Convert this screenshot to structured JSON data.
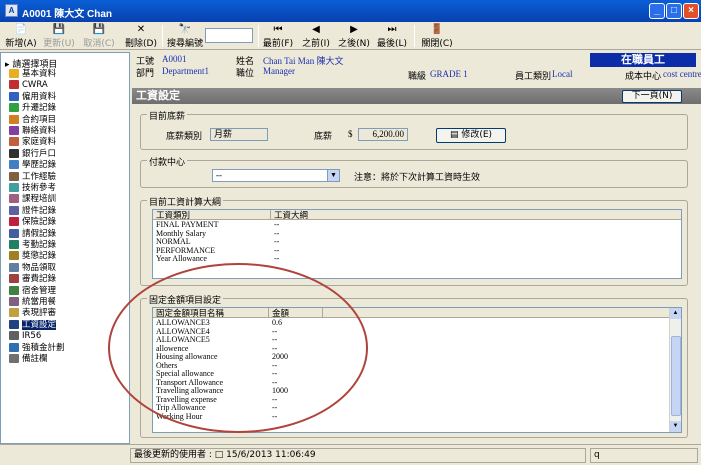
{
  "window": {
    "title": "A0001 陳大文 Chan",
    "min": "_",
    "max": "□",
    "close": "×"
  },
  "toolbar": {
    "new": "新增(A)",
    "update": "更新(U)",
    "cancel": "取消(C)",
    "delete": "刪除(D)",
    "search": "搜尋編號",
    "first": "最前(F)",
    "prev": "之前(I)",
    "next": "之後(N)",
    "last": "最後(L)",
    "close": "關閉(C)"
  },
  "tree": {
    "root": "請選擇項目",
    "items": [
      "基本資料",
      "CWRA",
      "僱用資料",
      "升遷記錄",
      "合約項目",
      "聯絡資料",
      "家庭資料",
      "銀行戶口",
      "學歷記錄",
      "工作經驗",
      "技術參考",
      "課程培訓",
      "證件記錄",
      "保險記錄",
      "請假記錄",
      "考勤記錄",
      "獎懲記錄",
      "物品領取",
      "審費記錄",
      "宿舍管理",
      "統當用餐",
      "表現評審",
      "工資設定",
      "IR56",
      "強積金計劃",
      "備註欄"
    ],
    "selected_index": 22
  },
  "header": {
    "emp_no_label": "工號",
    "emp_no": "A0001",
    "dept_label": "部門",
    "dept": "Department1",
    "name_label": "姓名",
    "name": "Chan Tai Man 陳大文",
    "position_label": "職位",
    "position": "Manager",
    "grade_label": "職級",
    "grade": "GRADE 1",
    "emp_type_label": "員工類別",
    "emp_type": "Local",
    "cost_center_label": "成本中心",
    "cost_center": "cost centre",
    "status": "在職員工"
  },
  "section": {
    "title": "工資設定",
    "next_btn": "下一頁(N)"
  },
  "base_salary": {
    "group": "目前底薪",
    "type_label": "底薪類別",
    "type_value": "月薪",
    "amount_label": "底薪",
    "currency": "$",
    "amount": "6,200.00",
    "edit_btn": "修改(E)"
  },
  "payment_center": {
    "group": "付款中心",
    "value": "--",
    "note": "注意：將於下次計算工資時生效"
  },
  "salary_outline": {
    "group": "目前工資計算大綱",
    "headers": [
      "工資類別",
      "工資大綱"
    ],
    "rows": [
      [
        "FINAL PAYMENT",
        "--"
      ],
      [
        "Monthly Salary",
        "--"
      ],
      [
        "NORMAL",
        "--"
      ],
      [
        "PERFORMANCE",
        "--"
      ],
      [
        "Year Allowance",
        "--"
      ]
    ]
  },
  "fixed_items": {
    "group": "固定金額項目設定",
    "headers": [
      "固定金額項目名稱",
      "金額"
    ],
    "rows": [
      [
        "ALLOWANCE3",
        "0.6"
      ],
      [
        "ALLOWANCE4",
        "--"
      ],
      [
        "ALLOWANCE5",
        "--"
      ],
      [
        "allowence",
        "--"
      ],
      [
        "Housing allowance",
        "2000"
      ],
      [
        "Others",
        "--"
      ],
      [
        "Special allowance",
        "--"
      ],
      [
        "Transport Allowance",
        "--"
      ],
      [
        "Travelling allowance",
        "1000"
      ],
      [
        "Travelling expense",
        "--"
      ],
      [
        "Trip Allowance",
        "--"
      ],
      [
        "Working Hour",
        "--"
      ]
    ]
  },
  "statusbar": {
    "last_user": "最後更新的使用者 : □ 15/6/2013 11:06:49",
    "right": "q"
  },
  "colors": {
    "title": "#0841b0",
    "banner": "#0b2ea8",
    "circle": "#b0433b"
  }
}
